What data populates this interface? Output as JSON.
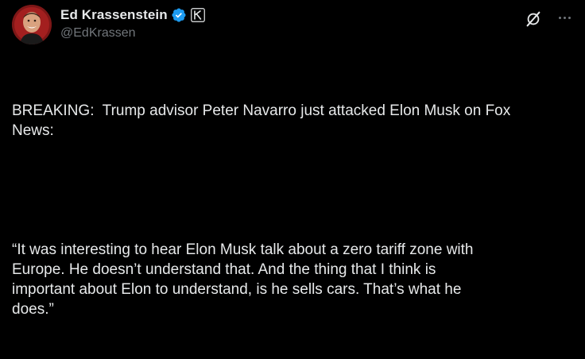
{
  "author": {
    "display_name": "Ed Krassenstein",
    "handle": "@EdKrassen",
    "verified_icon": "verified-badge-icon",
    "affiliate_icon": "k-badge-icon",
    "accent": "#1d9bf0"
  },
  "actions": {
    "grok_icon": "grok-icon",
    "more_icon": "more-options-icon"
  },
  "post": {
    "paragraph1": "BREAKING:  Trump advisor Peter Navarro just attacked Elon Musk on Fox\nNews:",
    "paragraph2": "“It was interesting to hear Elon Musk talk about a zero tariff zone with\nEurope. He doesn’t understand that. And the thing that I think is\nimportant about Elon to understand, is he sells cars. That’s what he\ndoes.”"
  }
}
